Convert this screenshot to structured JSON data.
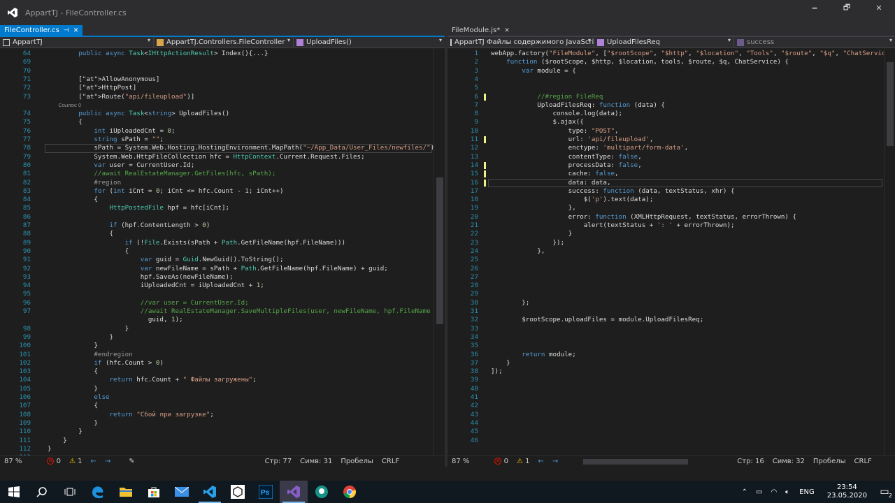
{
  "window": {
    "title": "AppartTJ - FileController.cs",
    "minimize": "🗕",
    "restore": "🗗",
    "close": "✕"
  },
  "left": {
    "tab": {
      "label": "FileController.cs",
      "pin": "⊣",
      "close": "✕"
    },
    "nav": {
      "project": "AppartTJ",
      "class": "AppartTJ.Controllers.FileController",
      "member": "UploadFiles()"
    },
    "lines": [
      {
        "n": "64",
        "t": "        public async Task<IHttpActionResult> Index(){...}"
      },
      {
        "n": "69",
        "t": ""
      },
      {
        "n": "70",
        "t": ""
      },
      {
        "n": "71",
        "t": "        [AllowAnonymous]"
      },
      {
        "n": "72",
        "t": "        [HttpPost]"
      },
      {
        "n": "73",
        "t": "        [Route(\"api/fileupload\")]"
      },
      {
        "n": "",
        "t": "        Ссылок: 0",
        "ref": true
      },
      {
        "n": "74",
        "t": "        public async Task<string> UploadFiles()"
      },
      {
        "n": "75",
        "t": "        {"
      },
      {
        "n": "76",
        "t": "            int iUploadedCnt = 0;"
      },
      {
        "n": "77",
        "t": "            string sPath = \"\";"
      },
      {
        "n": "78",
        "t": "            sPath = System.Web.Hosting.HostingEnvironment.MapPath(\"~/App_Data/User_Files/newfiles/\");"
      },
      {
        "n": "79",
        "t": "            System.Web.HttpFileCollection hfc = HttpContext.Current.Request.Files;"
      },
      {
        "n": "80",
        "t": "            var user = CurrentUser.Id;"
      },
      {
        "n": "81",
        "t": "            //await RealEstateManager.GetFiles(hfc, sPath);"
      },
      {
        "n": "82",
        "t": "            #region"
      },
      {
        "n": "83",
        "t": "            for (int iCnt = 0; iCnt <= hfc.Count - 1; iCnt++)"
      },
      {
        "n": "84",
        "t": "            {"
      },
      {
        "n": "85",
        "t": "                HttpPostedFile hpf = hfc[iCnt];"
      },
      {
        "n": "86",
        "t": ""
      },
      {
        "n": "87",
        "t": "                if (hpf.ContentLength > 0)"
      },
      {
        "n": "88",
        "t": "                {"
      },
      {
        "n": "89",
        "t": "                    if (!File.Exists(sPath + Path.GetFileName(hpf.FileName)))"
      },
      {
        "n": "90",
        "t": "                    {"
      },
      {
        "n": "91",
        "t": "                        var guid = Guid.NewGuid().ToString();"
      },
      {
        "n": "92",
        "t": "                        var newFileName = sPath + Path.GetFileName(hpf.FileName) + guid;"
      },
      {
        "n": "93",
        "t": "                        hpf.SaveAs(newFileName);"
      },
      {
        "n": "94",
        "t": "                        iUploadedCnt = iUploadedCnt + 1;"
      },
      {
        "n": "95",
        "t": ""
      },
      {
        "n": "96",
        "t": "                        //var user = CurrentUser.Id;"
      },
      {
        "n": "97",
        "t": "                        //await RealEstateManager.SaveMultipleFiles(user, newFileName, hpf.FileName +"
      },
      {
        "n": "",
        "t": "                          guid, 1);"
      },
      {
        "n": "98",
        "t": "                    }"
      },
      {
        "n": "99",
        "t": "                }"
      },
      {
        "n": "100",
        "t": "            }"
      },
      {
        "n": "101",
        "t": "            #endregion"
      },
      {
        "n": "102",
        "t": "            if (hfc.Count > 0)"
      },
      {
        "n": "103",
        "t": "            {"
      },
      {
        "n": "104",
        "t": "                return hfc.Count + \" Файлы загружены\";"
      },
      {
        "n": "105",
        "t": "            }"
      },
      {
        "n": "106",
        "t": "            else"
      },
      {
        "n": "107",
        "t": "            {"
      },
      {
        "n": "108",
        "t": "                return \"Сбой при загрузке\";"
      },
      {
        "n": "109",
        "t": "            }"
      },
      {
        "n": "110",
        "t": "        }"
      },
      {
        "n": "111",
        "t": "    }"
      },
      {
        "n": "112",
        "t": "}"
      },
      {
        "n": "113",
        "t": ""
      }
    ],
    "status": {
      "zoom": "87 %",
      "errors": "0",
      "warnings": "1",
      "line": "Стр: 77",
      "col": "Симв: 31",
      "spaces": "Пробелы",
      "eol": "CRLF"
    }
  },
  "right": {
    "tab": {
      "label": "FileModule.js*",
      "close": "✕"
    },
    "nav": {
      "project": "AppartTJ Файлы содержимого JavaScrip",
      "member": "UploadFilesReq",
      "sub": "success"
    },
    "lines": [
      {
        "n": "1",
        "t": "webApp.factory(\"FileModule\", [\"$rootScope\", \"$http\", \"$location\", \"Tools\", \"$route\", \"$q\", \"ChatService\","
      },
      {
        "n": "2",
        "t": "    function ($rootScope, $http, $location, tools, $route, $q, ChatService) {"
      },
      {
        "n": "3",
        "t": "        var module = {"
      },
      {
        "n": "4",
        "t": ""
      },
      {
        "n": "5",
        "t": ""
      },
      {
        "n": "6",
        "t": "            //#region FileReq"
      },
      {
        "n": "7",
        "t": "            UploadFilesReq: function (data) {"
      },
      {
        "n": "8",
        "t": "                console.log(data);"
      },
      {
        "n": "9",
        "t": "                $.ajax({"
      },
      {
        "n": "10",
        "t": "                    type: \"POST\","
      },
      {
        "n": "11",
        "t": "                    url: 'api/fileupload',"
      },
      {
        "n": "12",
        "t": "                    enctype: 'multipart/form-data',"
      },
      {
        "n": "13",
        "t": "                    contentType: false,"
      },
      {
        "n": "14",
        "t": "                    processData: false,"
      },
      {
        "n": "15",
        "t": "                    cache: false,"
      },
      {
        "n": "16",
        "t": "                    data: data,"
      },
      {
        "n": "17",
        "t": "                    success: function (data, textStatus, xhr) {"
      },
      {
        "n": "18",
        "t": "                        $('p').text(data);"
      },
      {
        "n": "19",
        "t": "                    },"
      },
      {
        "n": "20",
        "t": "                    error: function (XMLHttpRequest, textStatus, errorThrown) {"
      },
      {
        "n": "21",
        "t": "                        alert(textStatus + ': ' + errorThrown);"
      },
      {
        "n": "22",
        "t": "                    }"
      },
      {
        "n": "23",
        "t": "                });"
      },
      {
        "n": "24",
        "t": "            },"
      },
      {
        "n": "25",
        "t": ""
      },
      {
        "n": "26",
        "t": ""
      },
      {
        "n": "27",
        "t": ""
      },
      {
        "n": "28",
        "t": ""
      },
      {
        "n": "29",
        "t": ""
      },
      {
        "n": "30",
        "t": "        };"
      },
      {
        "n": "31",
        "t": ""
      },
      {
        "n": "32",
        "t": "        $rootScope.uploadFiles = module.UploadFilesReq;"
      },
      {
        "n": "33",
        "t": ""
      },
      {
        "n": "34",
        "t": ""
      },
      {
        "n": "35",
        "t": ""
      },
      {
        "n": "36",
        "t": "        return module;"
      },
      {
        "n": "37",
        "t": "    }"
      },
      {
        "n": "38",
        "t": "]);"
      },
      {
        "n": "39",
        "t": ""
      },
      {
        "n": "40",
        "t": ""
      },
      {
        "n": "41",
        "t": ""
      },
      {
        "n": "42",
        "t": ""
      },
      {
        "n": "43",
        "t": ""
      },
      {
        "n": "44",
        "t": ""
      },
      {
        "n": "45",
        "t": ""
      },
      {
        "n": "46",
        "t": ""
      }
    ],
    "status": {
      "zoom": "87 %",
      "errors": "0",
      "warnings": "1",
      "line": "Стр: 16",
      "col": "Симв: 32",
      "spaces": "Пробелы",
      "eol": "CRLF"
    }
  },
  "taskbar": {
    "lang": "ENG",
    "time": "23:54",
    "date": "23.05.2020",
    "notif_count": "2",
    "icons": [
      "windows-start-icon",
      "search-icon",
      "task-view-icon",
      "edge-icon",
      "file-explorer-icon",
      "store-icon",
      "mail-icon",
      "vscode-icon",
      "unity-icon",
      "photoshop-icon",
      "visual-studio-icon",
      "gitkraken-icon",
      "chrome-icon"
    ]
  }
}
